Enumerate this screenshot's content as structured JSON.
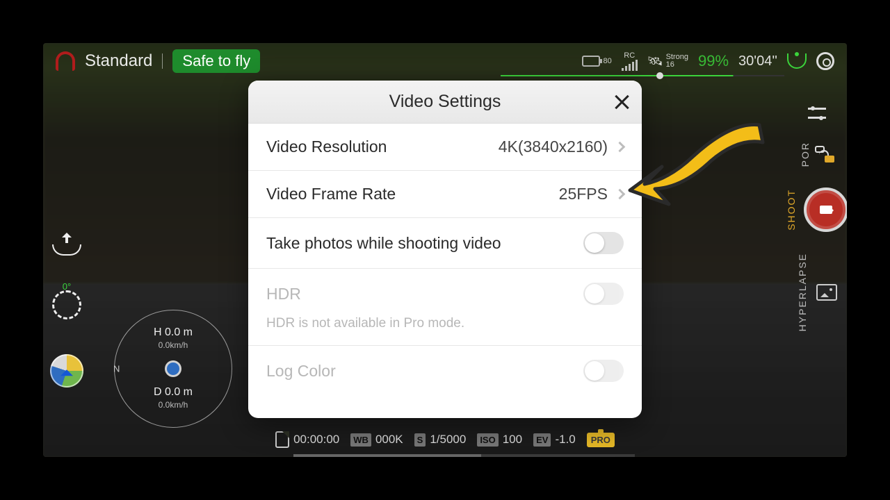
{
  "topbar": {
    "mode": "Standard",
    "status_pill": "Safe to fly",
    "battery_level": "80",
    "rc_label": "RC",
    "gps_label": "Strong",
    "gps_count": "16",
    "battery_pct": "99%",
    "flight_time": "30'04''"
  },
  "left": {
    "heading_deg": "0°"
  },
  "telemetry": {
    "n_mark": "N",
    "h_line": "H 0.0 m",
    "h_speed": "0.0km/h",
    "d_line": "D 0.0 m",
    "d_speed": "0.0km/h"
  },
  "right": {
    "label_por": "POR",
    "label_shoot": "SHOOT",
    "label_hyperlapse": "HYPERLAPSE"
  },
  "bottom": {
    "rec_time": "00:00:00",
    "wb_tag": "WB",
    "wb_val": "000K",
    "s_tag": "S",
    "s_val": "1/5000",
    "iso_tag": "ISO",
    "iso_val": "100",
    "ev_tag": "EV",
    "ev_val": "-1.0",
    "pro_tag": "PRO"
  },
  "modal": {
    "title": "Video Settings",
    "rows": {
      "resolution": {
        "label": "Video Resolution",
        "value": "4K(3840x2160)"
      },
      "framerate": {
        "label": "Video Frame Rate",
        "value": "25FPS"
      },
      "photos": {
        "label": "Take photos while shooting video"
      },
      "hdr": {
        "label": "HDR",
        "sub": "HDR is not available in Pro mode."
      },
      "log": {
        "label": "Log Color"
      }
    }
  }
}
